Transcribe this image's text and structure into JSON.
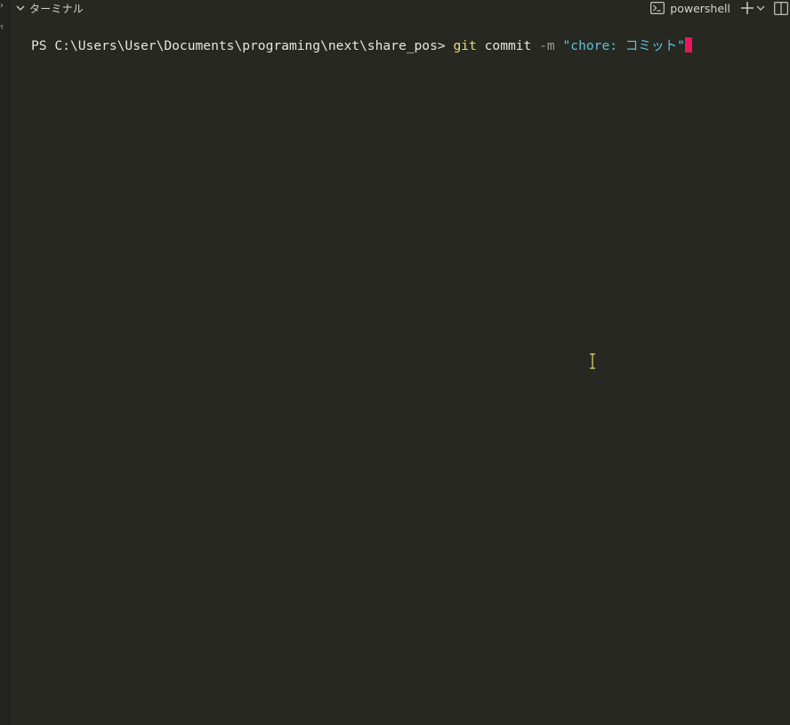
{
  "panel": {
    "title": "ターミナル",
    "shell_name": "powershell"
  },
  "terminal": {
    "prompt": "PS C:\\Users\\User\\Documents\\programing\\next\\share_pos> ",
    "command": "git",
    "arg": "commit",
    "flag": "-m",
    "string": "\"chore: コミット\""
  },
  "icons": {
    "collapse": "chevron-down-icon",
    "terminal": "terminal-icon",
    "new": "plus-icon",
    "dropdown": "chevron-down-icon",
    "split": "split-icon",
    "cursor": "text-cursor-icon"
  },
  "colors": {
    "background": "#272822",
    "command": "#e6db74",
    "string": "#5ec4d9",
    "flag": "#9c9c94",
    "cursor": "#e8175d"
  }
}
